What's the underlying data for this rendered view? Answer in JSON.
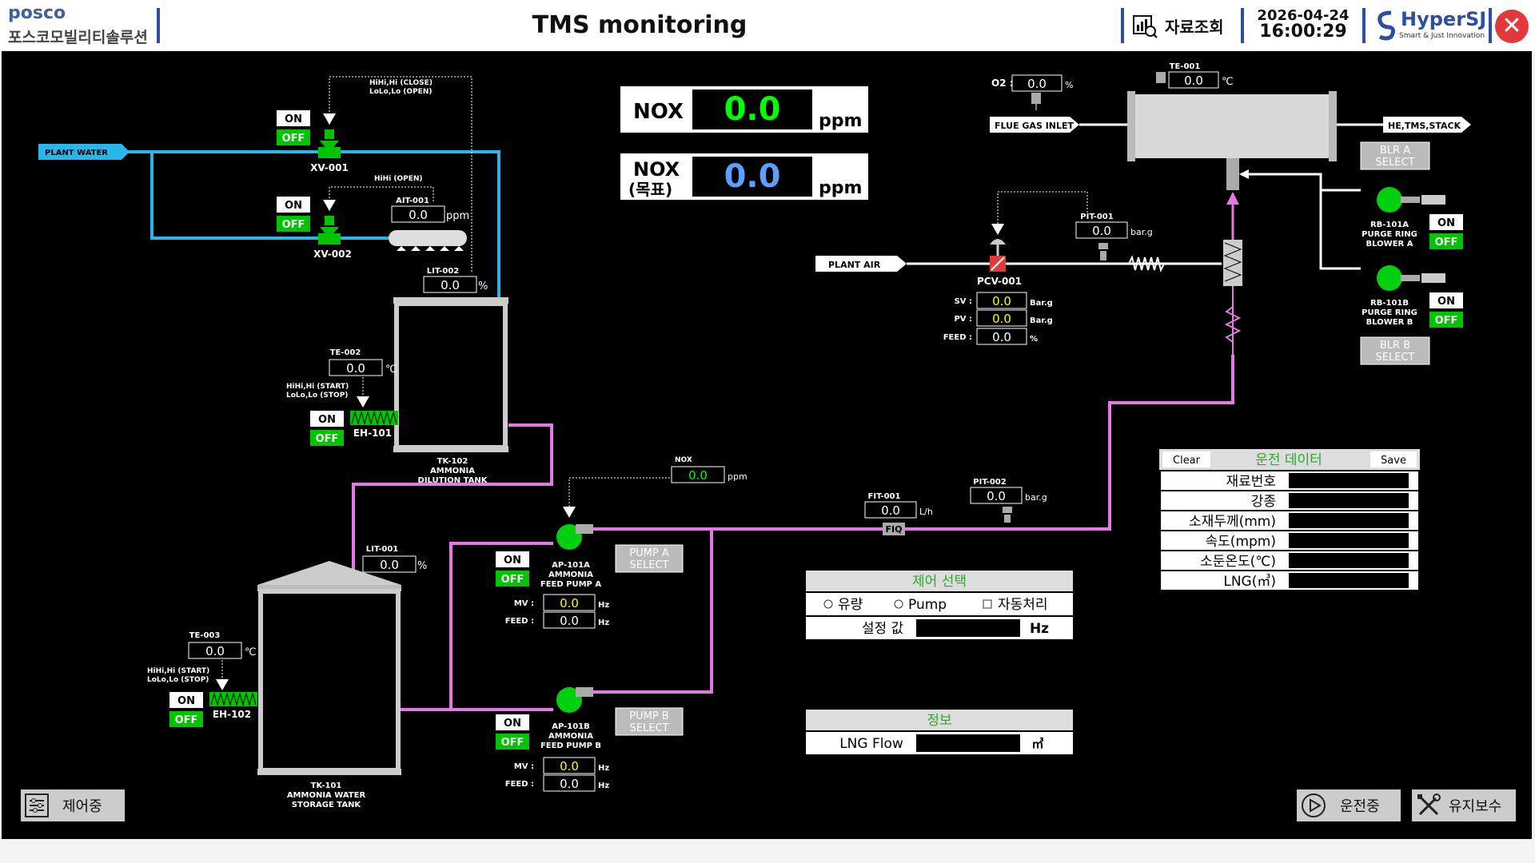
{
  "header": {
    "company_en": "posco",
    "company_kr": "포스코모빌리티솔루션",
    "title": "TMS monitoring",
    "data_query": "자료조회",
    "date": "2026-04-24",
    "time": "16:00:29",
    "brand": "HyperSJ",
    "brand_sub": "Smart & Just Innovation",
    "close_glyph": "✕"
  },
  "nox": {
    "label": "NOX",
    "value": "0.0",
    "unit": "ppm",
    "target_label_1": "NOX",
    "target_label_2": "(목표)",
    "target_value": "0.0",
    "target_unit": "ppm"
  },
  "water": {
    "plant_water": "PLANT WATER",
    "xv001": "XV-001",
    "xv002": "XV-002",
    "xv001_alarm_1": "HiHi,Hi (CLOSE)",
    "xv001_alarm_2": "LoLo,Lo (OPEN)",
    "xv002_alarm": "HiHi (OPEN)",
    "ait001": "AIT-001",
    "ait001_value": "0.0",
    "ait001_unit": "ppm",
    "lit002": "LIT-002",
    "lit002_value": "0.0",
    "lit002_unit": "%",
    "te002": "TE-002",
    "te002_value": "0.0",
    "te002_unit": "℃",
    "eh101_alarm_1": "HiHi,Hi (START)",
    "eh101_alarm_2": "LoLo,Lo (STOP)",
    "eh101": "EH-101",
    "tk102_1": "TK-102",
    "tk102_2": "AMMONIA",
    "tk102_3": "DILUTION TANK",
    "lit001": "LIT-001",
    "lit001_value": "0.0",
    "lit001_unit": "%",
    "te003": "TE-003",
    "te003_value": "0.0",
    "te003_unit": "℃",
    "eh102_alarm_1": "HiHi,Hi (START)",
    "eh102_alarm_2": "LoLo,Lo (STOP)",
    "eh102": "EH-102",
    "tk101_1": "TK-101",
    "tk101_2": "AMMONIA WATER",
    "tk101_3": "STORAGE TANK"
  },
  "toggle": {
    "on": "ON",
    "off": "OFF"
  },
  "pumps": {
    "nox_label": "NOX",
    "nox_value": "0.0",
    "nox_unit": "ppm",
    "a_1": "AP-101A",
    "a_2": "AMMONIA",
    "a_3": "FEED PUMP A",
    "a_select_1": "PUMP A",
    "a_select_2": "SELECT",
    "a_mv": "0.0",
    "a_feed": "0.0",
    "b_1": "AP-101B",
    "b_2": "AMMONIA",
    "b_3": "FEED PUMP B",
    "b_select_1": "PUMP B",
    "b_select_2": "SELECT",
    "b_mv": "0.0",
    "b_feed": "0.0",
    "mv_label": "MV :",
    "feed_label": "FEED :",
    "hz": "Hz",
    "fit001": "FIT-001",
    "fit001_value": "0.0",
    "fit001_unit": "L/h",
    "fiq": "FIQ",
    "pit002": "PIT-002",
    "pit002_value": "0.0",
    "pit002_unit": "bar.g"
  },
  "air": {
    "o2_label": "O2 :",
    "o2_value": "0.0",
    "o2_unit": "%",
    "te001": "TE-001",
    "te001_value": "0.0",
    "te001_unit": "℃",
    "flue_gas": "FLUE GAS INLET",
    "stack": "HE,TMS,STACK",
    "plant_air": "PLANT AIR",
    "pcv001": "PCV-001",
    "pit001": "PIT-001",
    "pit001_value": "0.0",
    "pit001_unit": "bar.g",
    "sv_label": "SV :",
    "sv_value": "0.0",
    "pv_label": "PV :",
    "pv_value": "0.0",
    "feed_label": "FEED :",
    "feed_value": "0.0",
    "barg": "Bar.g",
    "pct": "%",
    "blr_a_1": "BLR A",
    "blr_a_2": "SELECT",
    "blr_b_1": "BLR B",
    "blr_b_2": "SELECT",
    "rb_a_1": "RB-101A",
    "rb_a_2": "PURGE RING",
    "rb_a_3": "BLOWER A",
    "rb_b_1": "RB-101B",
    "rb_b_2": "PURGE RING",
    "rb_b_3": "BLOWER B"
  },
  "control": {
    "title": "제어 선택",
    "opt1": "유량",
    "opt2": "Pump",
    "opt3": "자동처리",
    "setpoint": "설정 값",
    "unit": "Hz"
  },
  "info": {
    "title": "정보",
    "lng_flow": "LNG Flow",
    "unit": "㎥"
  },
  "op_data": {
    "clear": "Clear",
    "title": "운전 데이터",
    "save": "Save",
    "rows": [
      "재료번호",
      "강종",
      "소재두께(mm)",
      "속도(mpm)",
      "소둔온도(℃)",
      "LNG(㎥)"
    ]
  },
  "bottom": {
    "control_mode": "제어중",
    "running": "운전중",
    "maintenance": "유지보수"
  },
  "colors": {
    "water_pipe": "#2ab6ea",
    "ammonia_pipe": "#e678e6",
    "on_bg": "#ffffff",
    "off_bg": "#00c400",
    "pump_green": "#00d010",
    "nox_value": "#00ff00",
    "nox_target": "#5aa0ff"
  }
}
